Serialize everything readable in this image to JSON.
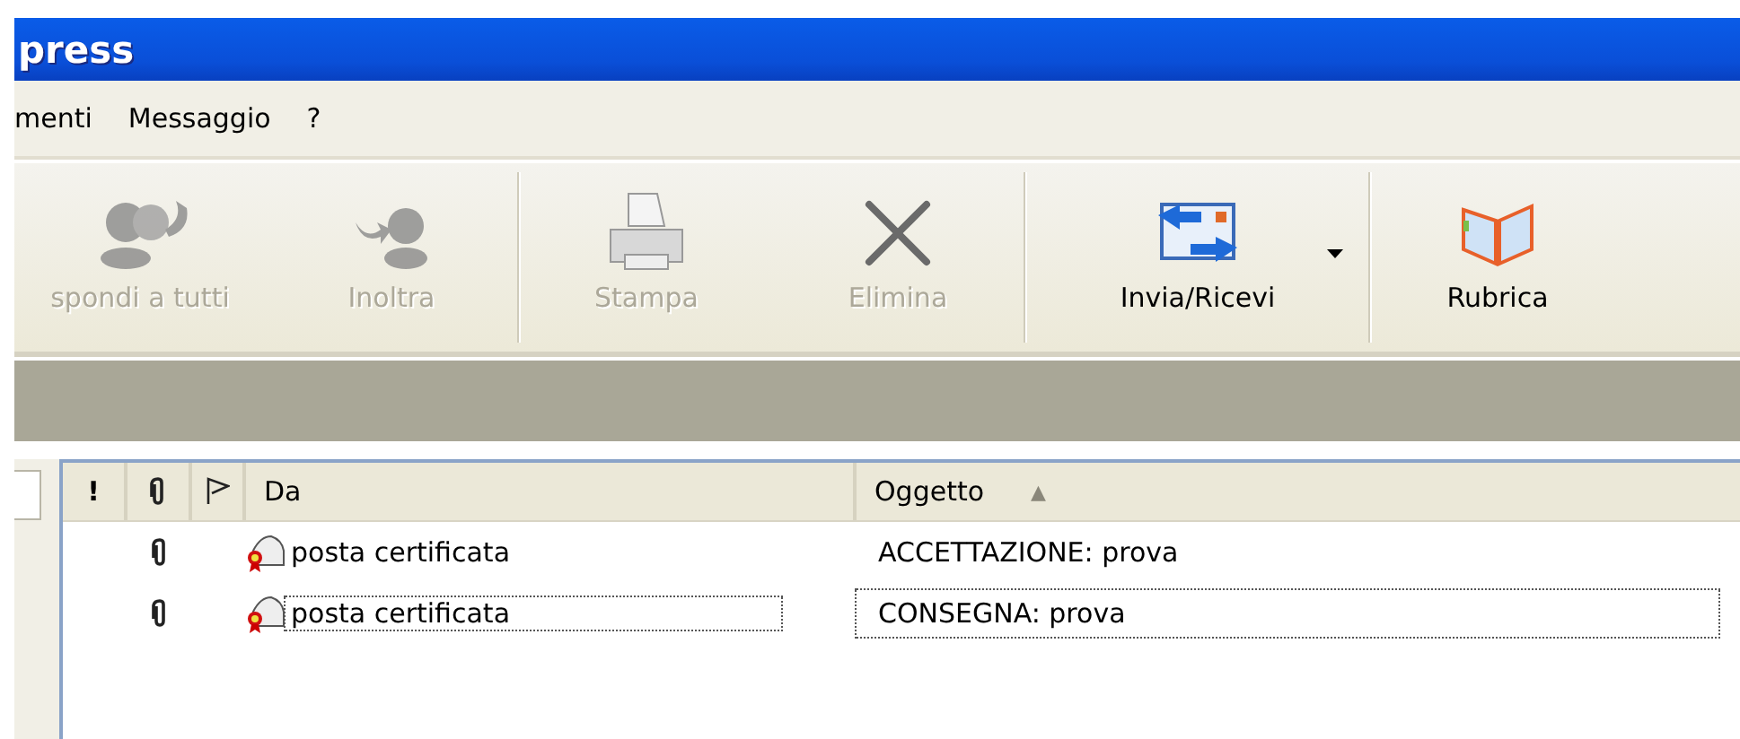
{
  "window": {
    "title": "press"
  },
  "menu": [
    "menti",
    "Messaggio",
    "?"
  ],
  "toolbar": [
    {
      "label": "spondi a tutti",
      "kind": "reply-all",
      "disabled": true
    },
    {
      "label": "Inoltra",
      "kind": "forward",
      "disabled": true
    },
    {
      "kind": "separator"
    },
    {
      "label": "Stampa",
      "kind": "print",
      "disabled": true
    },
    {
      "label": "Elimina",
      "kind": "delete",
      "disabled": true
    },
    {
      "kind": "separator"
    },
    {
      "label": "Invia/Ricevi",
      "kind": "send-receive",
      "disabled": false,
      "dropdown": true
    },
    {
      "kind": "separator"
    },
    {
      "label": "Rubrica",
      "kind": "address-book",
      "disabled": false
    }
  ],
  "message_list": {
    "columns": [
      {
        "kind": "priority",
        "label": "!"
      },
      {
        "kind": "attachment"
      },
      {
        "kind": "flag"
      },
      {
        "kind": "text",
        "label": "Da"
      },
      {
        "kind": "text",
        "label": "Oggetto",
        "sort": "▲"
      }
    ],
    "rows": [
      {
        "attachment": true,
        "from": "posta certificata",
        "subject": "ACCETTAZIONE: prova",
        "focused": false
      },
      {
        "attachment": true,
        "from": "posta certificata",
        "subject": "CONSEGNA: prova",
        "focused": true
      }
    ]
  }
}
